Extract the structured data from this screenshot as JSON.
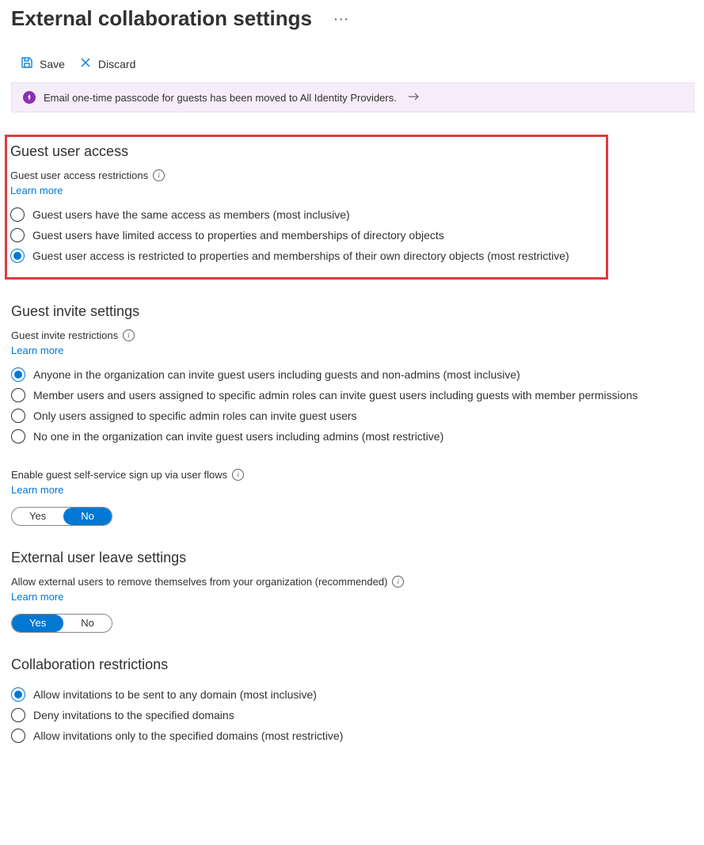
{
  "title": "External collaboration settings",
  "toolbar": {
    "save_label": "Save",
    "discard_label": "Discard"
  },
  "notice": {
    "text": "Email one-time passcode for guests has been moved to All Identity Providers."
  },
  "sections": {
    "guestAccess": {
      "title": "Guest user access",
      "fieldLabel": "Guest user access restrictions",
      "learn": "Learn more",
      "options": [
        "Guest users have the same access as members (most inclusive)",
        "Guest users have limited access to properties and memberships of directory objects",
        "Guest user access is restricted to properties and memberships of their own directory objects (most restrictive)"
      ],
      "selected": 2
    },
    "guestInvite": {
      "title": "Guest invite settings",
      "fieldLabel": "Guest invite restrictions",
      "learn": "Learn more",
      "options": [
        "Anyone in the organization can invite guest users including guests and non-admins (most inclusive)",
        "Member users and users assigned to specific admin roles can invite guest users including guests with member permissions",
        "Only users assigned to specific admin roles can invite guest users",
        "No one in the organization can invite guest users including admins (most restrictive)"
      ],
      "selected": 0
    },
    "selfService": {
      "fieldLabel": "Enable guest self-service sign up via user flows",
      "learn": "Learn more",
      "yes": "Yes",
      "no": "No",
      "value": "No"
    },
    "leave": {
      "title": "External user leave settings",
      "fieldLabel": "Allow external users to remove themselves from your organization (recommended)",
      "learn": "Learn more",
      "yes": "Yes",
      "no": "No",
      "value": "Yes"
    },
    "collab": {
      "title": "Collaboration restrictions",
      "options": [
        "Allow invitations to be sent to any domain (most inclusive)",
        "Deny invitations to the specified domains",
        "Allow invitations only to the specified domains (most restrictive)"
      ],
      "selected": 0
    }
  }
}
